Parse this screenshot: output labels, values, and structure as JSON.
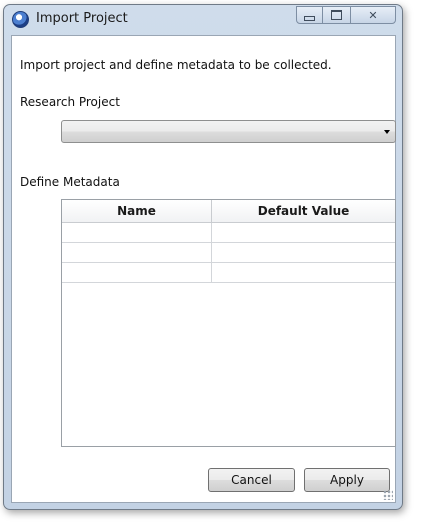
{
  "window": {
    "title": "Import Project"
  },
  "caption_buttons": {
    "minimize": "minimize-icon",
    "maximize": "maximize-icon",
    "close": "✕"
  },
  "content": {
    "description": "Import project and define metadata to be collected.",
    "research_project_label": "Research Project",
    "research_project_value": "",
    "define_metadata_label": "Define Metadata"
  },
  "table": {
    "headers": [
      "Name",
      "Default Value"
    ],
    "rows": [
      [
        "",
        ""
      ],
      [
        "",
        ""
      ],
      [
        "",
        ""
      ]
    ]
  },
  "buttons": {
    "cancel": "Cancel",
    "apply": "Apply"
  }
}
